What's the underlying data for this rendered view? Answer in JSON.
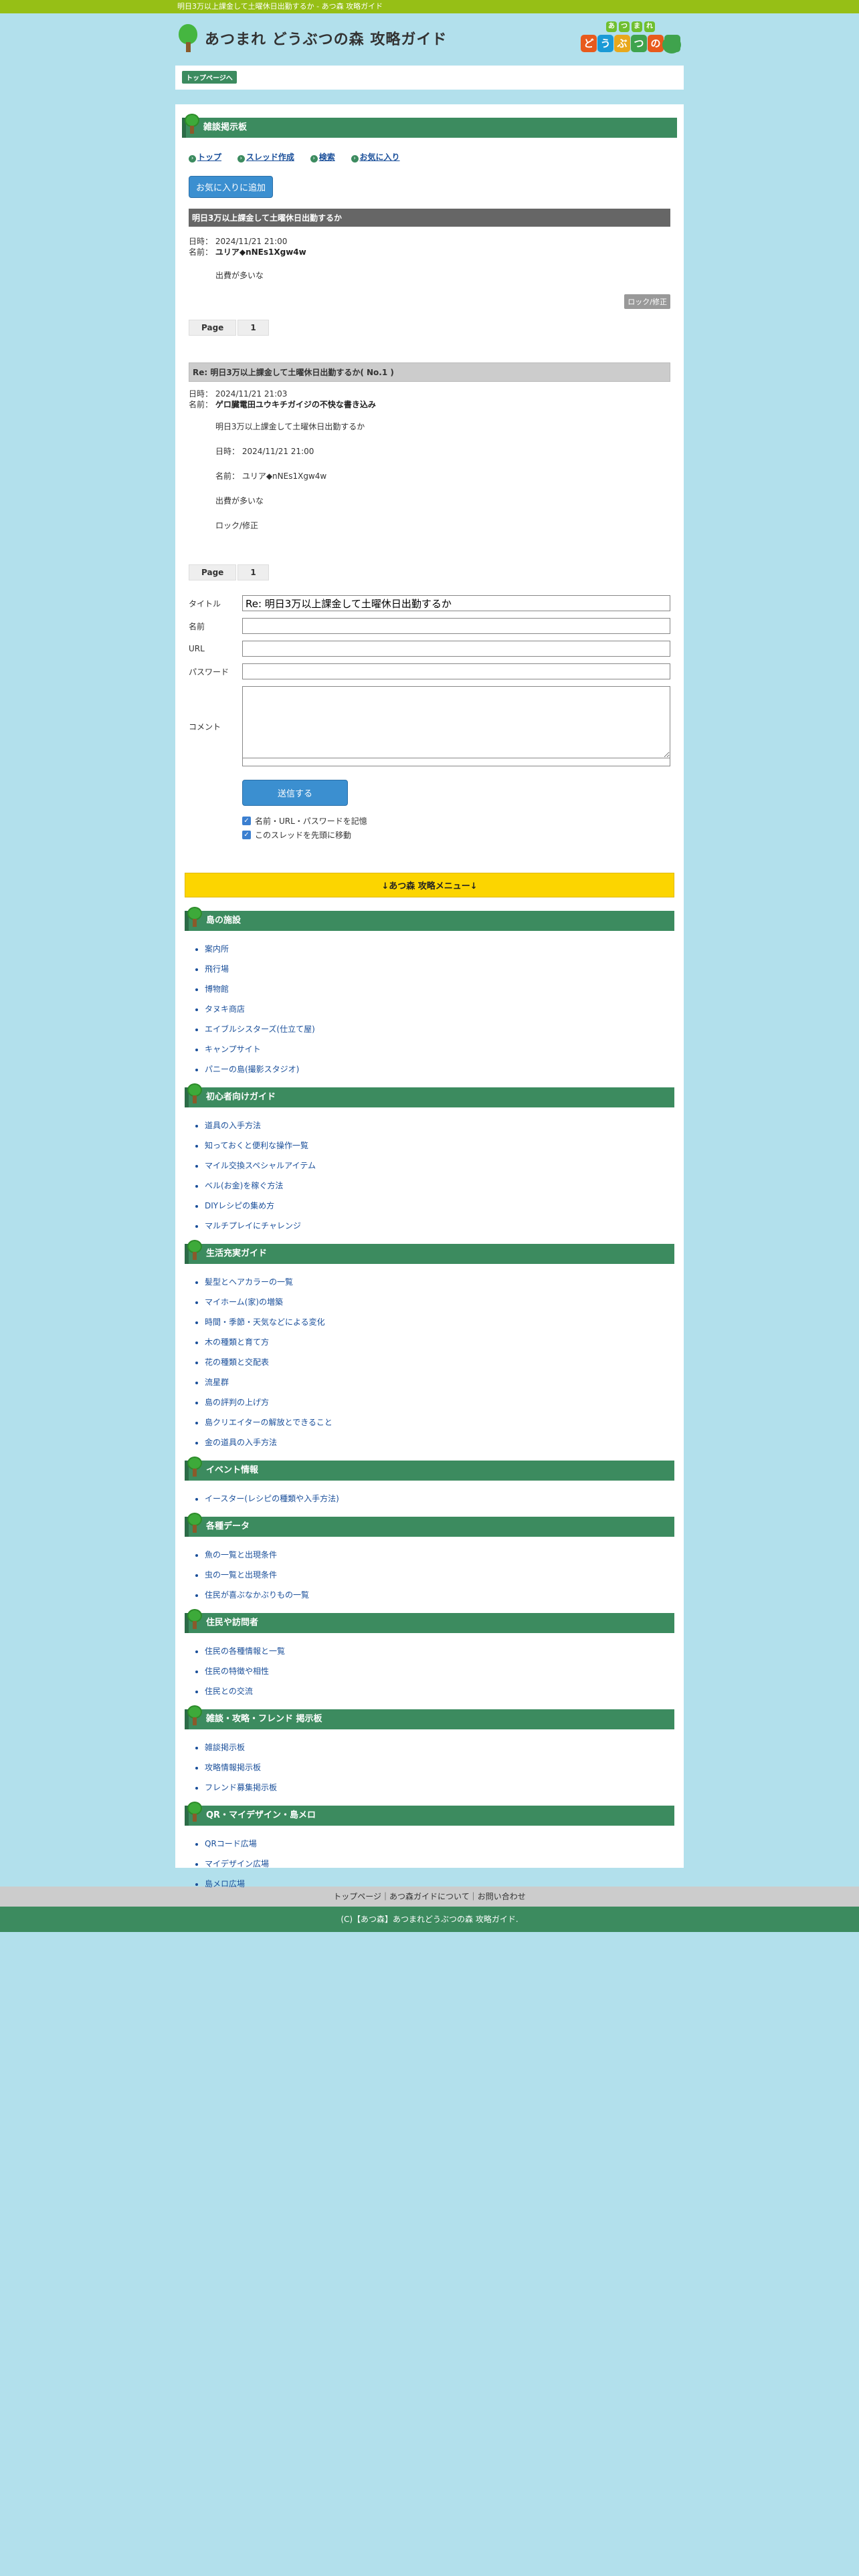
{
  "topbar_text": "明日3万以上課金して土曜休日出勤するか - あつ森 攻略ガイド",
  "site_title": "あつまれ どうぶつの森 攻略ガイド",
  "logo": {
    "small_text": [
      "あ",
      "つ",
      "ま",
      "れ"
    ],
    "big_text": [
      "ど",
      "う",
      "ぶ",
      "つ",
      "の",
      "森"
    ],
    "big_colors": [
      "#e85a1c",
      "#1a9ad6",
      "#e8a81c",
      "#3fa34d",
      "#e85a1c",
      "#3fa34d"
    ]
  },
  "breadcrumb": "トップページへ",
  "bbs": {
    "section_title": "雑談掲示板",
    "nav": [
      "トップ",
      "スレッド作成",
      "検索",
      "お気に入り"
    ],
    "favorite_button": "お気に入りに追加",
    "thread": {
      "title": "明日3万以上課金して土曜休日出勤するか",
      "date_label": "日時：",
      "date": "2024/11/21 21:00",
      "name_label": "名前：",
      "name": "ユリア◆nNEs1Xgw4w",
      "body": "出費が多いな",
      "lock_button": "ロック/修正"
    },
    "pager": {
      "label": "Page",
      "page": "1"
    },
    "reply": {
      "title": "Re: 明日3万以上課金して土曜休日出勤するか( No.1 )",
      "date_label": "日時：",
      "date": "2024/11/21 21:03",
      "name_label": "名前：",
      "name": "ゲロ臓電田ユウキチガイジの不快な書き込み",
      "lines": [
        "明日3万以上課金して土曜休日出勤するか",
        "日時： 2024/11/21 21:00",
        "名前： ユリア◆nNEs1Xgw4w",
        "出費が多いな",
        "ロック/修正"
      ]
    },
    "pager2": {
      "label": "Page",
      "page": "1"
    }
  },
  "form": {
    "title_label": "タイトル",
    "title_value": "Re: 明日3万以上課金して土曜休日出勤するか",
    "name_label": "名前",
    "url_label": "URL",
    "password_label": "パスワード",
    "comment_label": "コメント",
    "submit": "送信する",
    "remember": "名前・URL・パスワードを記憶",
    "move_top": "このスレッドを先頭に移動"
  },
  "menu_bar": "↓あつ森 攻略メニュー↓",
  "guide": [
    {
      "title": "島の施設",
      "items": [
        "案内所",
        "飛行場",
        "博物館",
        "タヌキ商店",
        "エイブルシスターズ(仕立て屋)",
        "キャンプサイト",
        "パニーの島(撮影スタジオ)"
      ]
    },
    {
      "title": "初心者向けガイド",
      "items": [
        "道具の入手方法",
        "知っておくと便利な操作一覧",
        "マイル交換スペシャルアイテム",
        "ベル(お金)を稼ぐ方法",
        "DIYレシピの集め方",
        "マルチプレイにチャレンジ"
      ]
    },
    {
      "title": "生活充実ガイド",
      "items": [
        "髪型とヘアカラーの一覧",
        "マイホーム(家)の増築",
        "時間・季節・天気などによる変化",
        "木の種類と育て方",
        "花の種類と交配表",
        "流星群",
        "島の評判の上げ方",
        "島クリエイターの解放とできること",
        "金の道具の入手方法"
      ]
    },
    {
      "title": "イベント情報",
      "items": [
        "イースター(レシピの種類や入手方法)"
      ]
    },
    {
      "title": "各種データ",
      "items": [
        "魚の一覧と出現条件",
        "虫の一覧と出現条件",
        "住民が喜ぶなかぶりもの一覧"
      ]
    },
    {
      "title": "住民や訪問者",
      "items": [
        "住民の各種情報と一覧",
        "住民の特徴や相性",
        "住民との交流"
      ]
    },
    {
      "title": "雑談・攻略・フレンド 掲示板",
      "items": [
        "雑談掲示板",
        "攻略情報掲示板",
        "フレンド募集掲示板"
      ]
    },
    {
      "title": "QR・マイデザイン・島メロ",
      "items": [
        "QRコード広場",
        "マイデザイン広場",
        "島メロ広場"
      ]
    }
  ],
  "footer": {
    "nav": "トップページ｜あつ森ガイドについて｜お問い合わせ",
    "copyright": "(C)【あつ森】あつまれどうぶつの森 攻略ガイド."
  }
}
